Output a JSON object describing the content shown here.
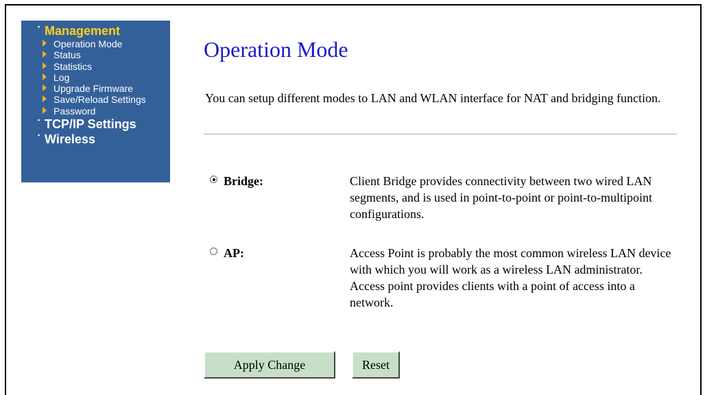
{
  "sidebar": {
    "sections": [
      {
        "label": "Management",
        "active": true,
        "items": [
          {
            "label": "Operation Mode"
          },
          {
            "label": "Status"
          },
          {
            "label": "Statistics"
          },
          {
            "label": "Log"
          },
          {
            "label": "Upgrade Firmware"
          },
          {
            "label": "Save/Reload Settings"
          },
          {
            "label": "Password"
          }
        ]
      },
      {
        "label": "TCP/IP Settings",
        "active": false
      },
      {
        "label": "Wireless",
        "active": false
      }
    ]
  },
  "main": {
    "title": "Operation Mode",
    "intro": "You can setup different modes to LAN and WLAN interface for NAT and bridging function.",
    "modes": [
      {
        "label": "Bridge:",
        "checked": true,
        "description": "Client Bridge provides connectivity between two wired LAN segments, and is used in point-to-point or point-to-multipoint configurations."
      },
      {
        "label": "AP:",
        "checked": false,
        "description": "Access Point is probably the most common wireless LAN device with which you will work as a wireless LAN administrator. Access point provides clients with a point of access into a network."
      }
    ],
    "buttons": {
      "apply": "Apply Change",
      "reset": "Reset"
    }
  },
  "colors": {
    "sidebar_bg": "#34609a",
    "active_section": "#ffd020",
    "title": "#1a1acc",
    "button_bg": "#c6dfc6"
  }
}
